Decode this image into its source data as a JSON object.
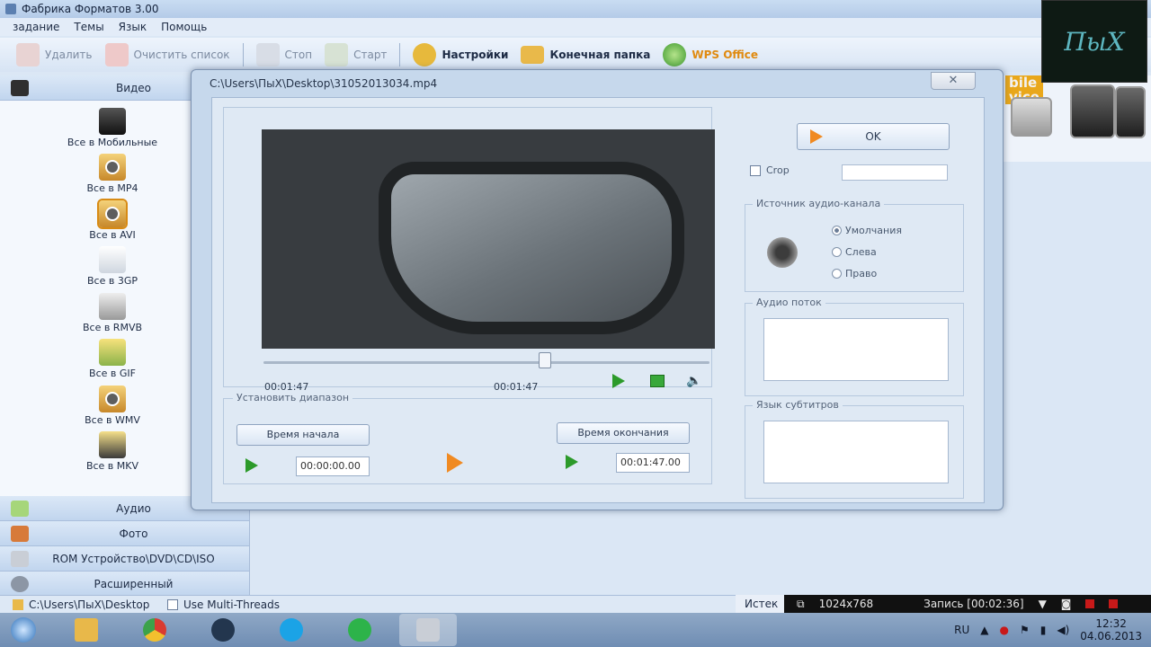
{
  "app": {
    "title": "Фабрика Форматов 3.00"
  },
  "menu": [
    "задание",
    "Темы",
    "Язык",
    "Помощь"
  ],
  "toolbar": {
    "delete": "Удалить",
    "clear": "Очистить список",
    "stop": "Стоп",
    "start": "Старт",
    "settings": "Настройки",
    "output": "Конечная папка",
    "wps": "WPS Office"
  },
  "sidebar": {
    "video": "Видео",
    "items": [
      "Все в Мобильные",
      "Все в MP4",
      "Все в AVI",
      "Все в 3GP",
      "Все в RMVB",
      "Все в GIF",
      "Все в WMV",
      "Все в MKV"
    ],
    "audio": "Аудио",
    "photo": "Фото",
    "rom": "ROM Устройство\\DVD\\CD\\ISO",
    "advanced": "Расширенный"
  },
  "right_panel": {
    "mobile_badge": "bile\nvice"
  },
  "watermark": "ПыХ",
  "dialog": {
    "title": "C:\\Users\\ПыХ\\Desktop\\31052013034.mp4",
    "close": "✕",
    "time_current": "00:01:47",
    "time_total": "00:01:47",
    "range_legend": "Установить диапазон",
    "start_btn": "Время начала",
    "end_btn": "Время окончания",
    "start_value": "00:00:00.00",
    "end_value": "00:01:47.00",
    "ok": "OK",
    "crop": "Crop",
    "audio_source_legend": "Источник аудио-канала",
    "radio": [
      "Умолчания",
      "Слева",
      "Право"
    ],
    "audio_stream_legend": "Аудио поток",
    "subtitle_legend": "Язык субтитров"
  },
  "status": {
    "path": "C:\\Users\\ПыХ\\Desktop",
    "multithread": "Use Multi-Threads",
    "source_label": "Истек"
  },
  "recorder": {
    "resolution": "1024x768",
    "record": "Запись [00:02:36]"
  },
  "taskbar": {
    "lang": "RU",
    "time": "12:32",
    "date": "04.06.2013"
  }
}
